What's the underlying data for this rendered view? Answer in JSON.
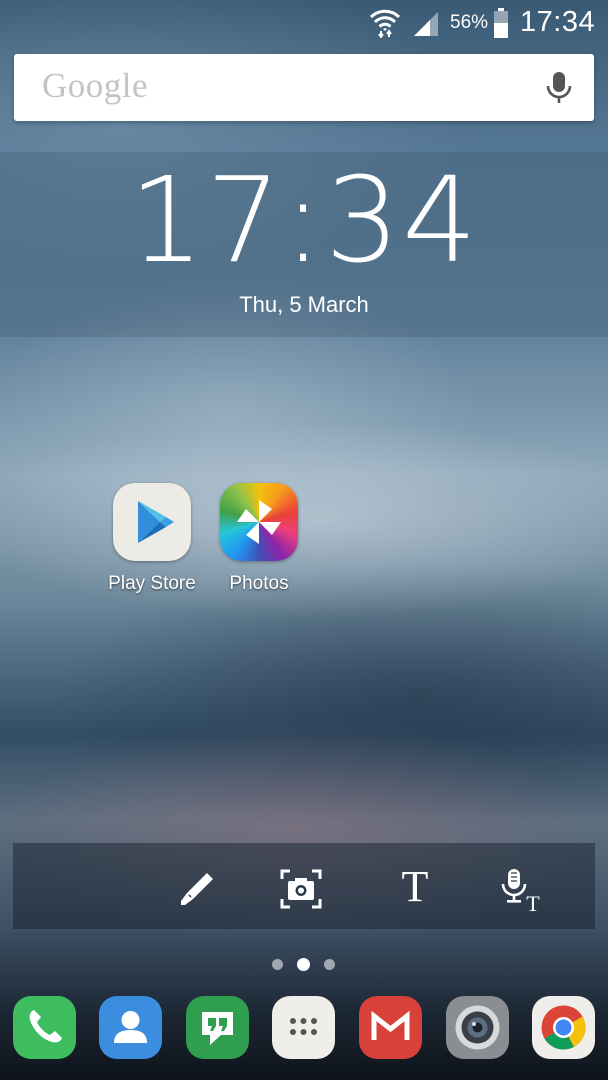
{
  "status_bar": {
    "battery_percent": "56%",
    "time": "17:34",
    "icons": [
      "wifi-icon",
      "signal-icon",
      "battery-icon"
    ]
  },
  "search": {
    "logo": "Google",
    "mic_icon": "mic-icon"
  },
  "clock_widget": {
    "time": "17:34",
    "date": "Thu, 5 March"
  },
  "home_apps": [
    {
      "label": "Play Store",
      "icon": "play-store-icon"
    },
    {
      "label": "Photos",
      "icon": "photos-icon"
    }
  ],
  "pen_toolbar": {
    "tools": [
      "pen-icon",
      "screen-capture-icon",
      "text-icon",
      "voice-to-text-icon"
    ],
    "text_glyph": "T"
  },
  "page_indicator": {
    "count": 3,
    "active": 1
  },
  "dock": {
    "apps": [
      "phone-icon",
      "contacts-icon",
      "hangouts-icon",
      "app-drawer-icon",
      "gmail-icon",
      "camera-icon",
      "chrome-icon"
    ]
  },
  "colors": {
    "phone": "#3dbd5d",
    "contacts": "#3b8de0",
    "hangouts": "#2f9e4f",
    "gmail": "#d8413a",
    "chrome_red": "#db4437",
    "chrome_yellow": "#f4c20d",
    "chrome_green": "#0f9d58",
    "chrome_blue": "#4285f4"
  }
}
